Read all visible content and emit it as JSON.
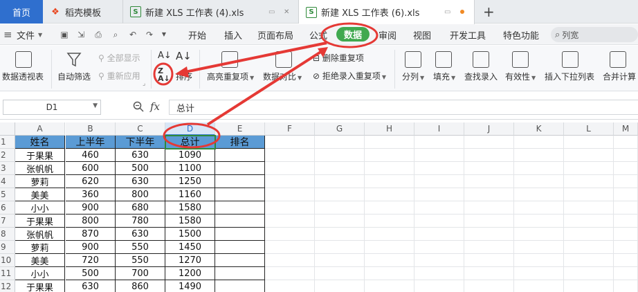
{
  "tabs": {
    "home_label": "首页",
    "items": [
      {
        "label": "稻壳模板",
        "icon": "daoke-icon"
      },
      {
        "label": "新建 XLS 工作表 (4).xls",
        "icon": "spreadsheet-icon"
      },
      {
        "label": "新建 XLS 工作表 (6).xls",
        "icon": "spreadsheet-icon",
        "active": true
      }
    ],
    "new_tab_label": "+"
  },
  "menubar": {
    "file_label": "文件",
    "tabs": [
      "开始",
      "插入",
      "页面布局",
      "公式",
      "数据",
      "审阅",
      "视图",
      "开发工具",
      "特色功能"
    ],
    "active_tab": "数据",
    "search_text": "列宽"
  },
  "ribbon": {
    "pivot_label": "数据透视表",
    "autofilter_label": "自动筛选",
    "show_all_label": "全部显示",
    "reapply_label": "重新应用",
    "sort_label": "排序",
    "highlight_dup_label": "高亮重复项",
    "delete_dup_label": "删除重复项",
    "reject_dup_label": "拒绝录入重复项",
    "compare_label": "数据对比",
    "split_label": "分列",
    "fill_label": "填充",
    "lookup_label": "查找录入",
    "validity_label": "有效性",
    "dropdown_list_label": "插入下拉列表",
    "merge_calc_label": "合并计算"
  },
  "formula_bar": {
    "name_box": "D1",
    "fx_label": "fx",
    "formula": "总计"
  },
  "sheet": {
    "columns": [
      "A",
      "B",
      "C",
      "D",
      "E",
      "F",
      "G",
      "H",
      "I",
      "J",
      "K",
      "L",
      "M"
    ],
    "rows": [
      "1",
      "2",
      "3",
      "4",
      "5",
      "6",
      "7",
      "8",
      "9",
      "10",
      "11",
      "12"
    ],
    "selected_cell": "D1",
    "header": [
      "姓名",
      "上半年",
      "下半年",
      "总计",
      "排名"
    ],
    "data": [
      [
        "于果果",
        "460",
        "630",
        "1090"
      ],
      [
        "张帆帆",
        "600",
        "500",
        "1100"
      ],
      [
        "萝莉",
        "620",
        "630",
        "1250"
      ],
      [
        "美美",
        "360",
        "800",
        "1160"
      ],
      [
        "小小",
        "900",
        "680",
        "1580"
      ],
      [
        "于果果",
        "800",
        "780",
        "1580"
      ],
      [
        "张帆帆",
        "870",
        "630",
        "1500"
      ],
      [
        "萝莉",
        "900",
        "550",
        "1450"
      ],
      [
        "美美",
        "720",
        "550",
        "1270"
      ],
      [
        "小小",
        "500",
        "700",
        "1200"
      ],
      [
        "于果果",
        "630",
        "860",
        "1490"
      ]
    ]
  },
  "colors": {
    "accent": "#2f6fce",
    "data_tab": "#40a94f",
    "header_fill": "#5b9bd5",
    "annotation": "#e53935"
  }
}
